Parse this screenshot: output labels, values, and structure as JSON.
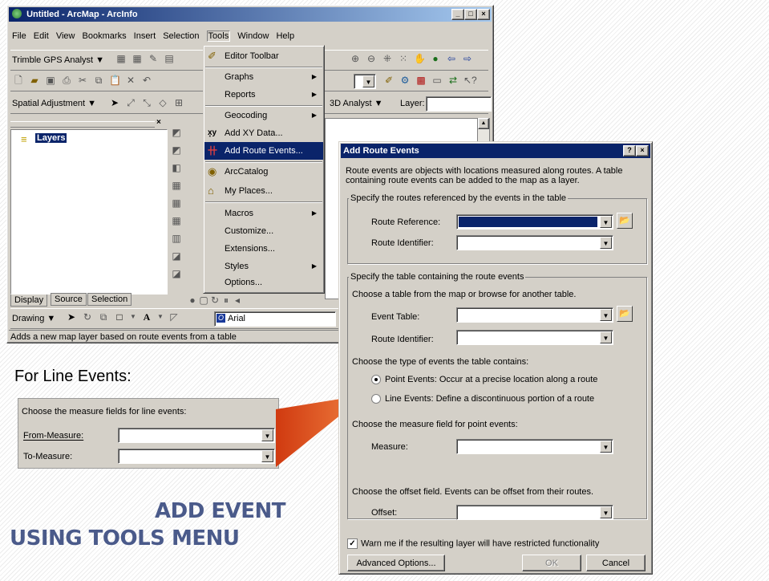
{
  "arcmap": {
    "title": "Untitled - ArcMap - ArcInfo",
    "menu": [
      "File",
      "Edit",
      "View",
      "Bookmarks",
      "Insert",
      "Selection",
      "Tools",
      "Window",
      "Help"
    ],
    "toolbar_gps": "Trimble GPS Analyst ▼",
    "toolbar_spatial": "Spatial Adjustment ▼",
    "toolbar_3d": "3D Analyst ▼",
    "layer_label": "Layer:",
    "toc_root": "Layers",
    "tabs": [
      "Display",
      "Source",
      "Selection"
    ],
    "drawing_label": "Drawing ▼",
    "font_name": "Arial",
    "status_text": "Adds a new map layer based on route events from a table"
  },
  "tools_menu": {
    "items": [
      {
        "label": "Editor Toolbar",
        "arrow": false
      },
      {
        "label": "Graphs",
        "arrow": true
      },
      {
        "label": "Reports",
        "arrow": true
      },
      {
        "label": "Geocoding",
        "arrow": true
      },
      {
        "label": "Add XY Data...",
        "arrow": false
      },
      {
        "label": "Add Route Events...",
        "arrow": false
      },
      {
        "label": "ArcCatalog",
        "arrow": false
      },
      {
        "label": "My Places...",
        "arrow": false
      },
      {
        "label": "Macros",
        "arrow": true
      },
      {
        "label": "Customize...",
        "arrow": false
      },
      {
        "label": "Extensions...",
        "arrow": false
      },
      {
        "label": "Styles",
        "arrow": true
      },
      {
        "label": "Options...",
        "arrow": false
      }
    ]
  },
  "dialog": {
    "title": "Add Route Events",
    "title_buttons": [
      "?",
      "×"
    ],
    "intro": "Route events are objects with locations measured along routes. A table containing route events can be added to the map as a layer.",
    "group1_label": "Specify the routes referenced by the events in the table",
    "route_reference_label": "Route Reference:",
    "route_identifier_label": "Route Identifier:",
    "group2_label": "Specify the table containing the route events",
    "choose_table_text": "Choose a table from the map or browse for another table.",
    "event_table_label": "Event Table:",
    "route_identifier2_label": "Route Identifier:",
    "event_type_text": "Choose the type of events the table contains:",
    "point_events_label": "Point Events: Occur at a precise location along a route",
    "line_events_label": "Line Events: Define a discontinuous portion of a route",
    "measure_field_text": "Choose the measure field for point events:",
    "measure_label": "Measure:",
    "offset_text": "Choose the offset field. Events can be offset from their routes.",
    "offset_label": "Offset:",
    "warn_label": "Warn me if the resulting layer will have restricted functionality",
    "advanced_button": "Advanced Options...",
    "ok_button": "OK",
    "cancel_button": "Cancel"
  },
  "line_events_panel": {
    "caption": "For Line Events:",
    "heading": "Choose the measure fields for line events:",
    "from_label": "From-Measure:",
    "to_label": "To-Measure:"
  },
  "slide_title": {
    "line1": "ADD EVENT",
    "line2": "USING TOOLS MENU"
  },
  "colors": {
    "title_blue": "#0a246a",
    "slide_text": "#4a5a8a",
    "callout_orange": "#e8521a"
  }
}
